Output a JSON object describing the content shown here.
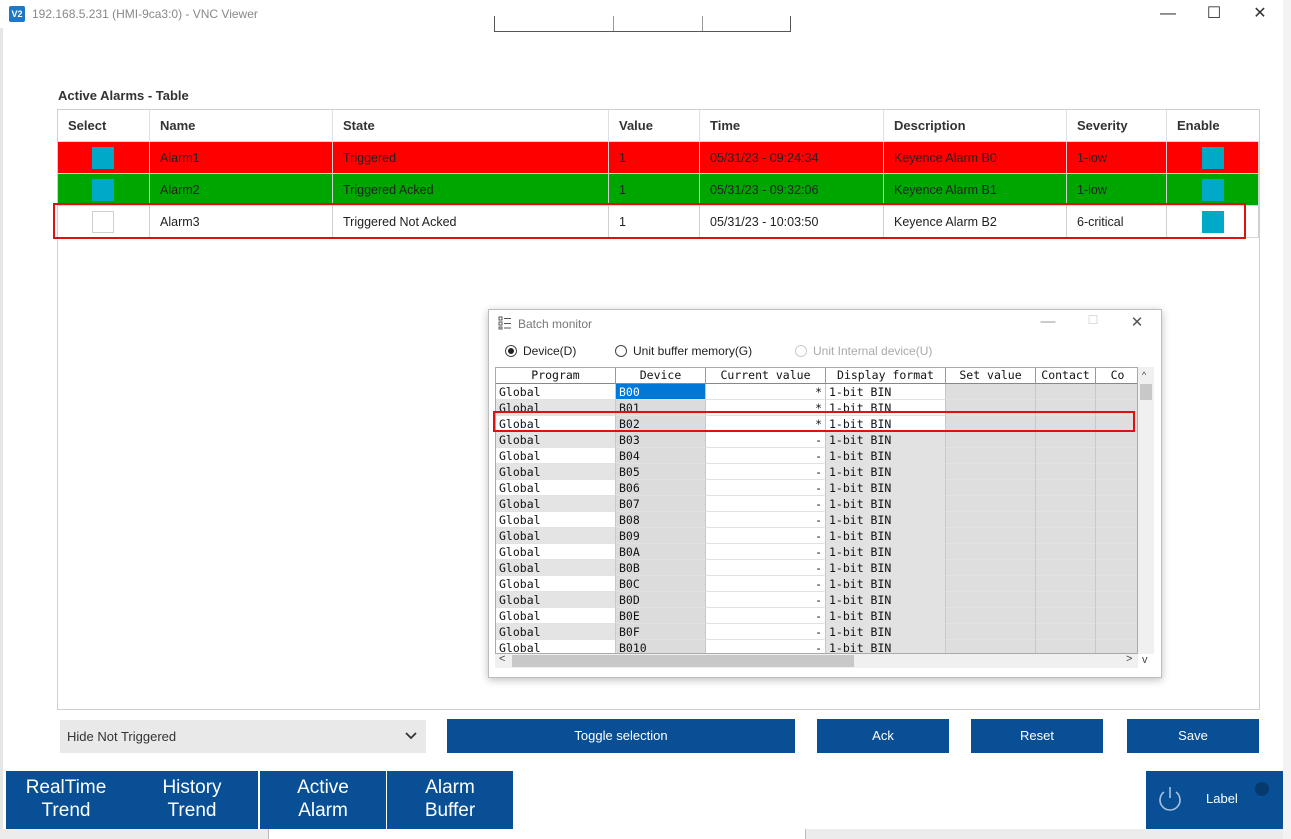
{
  "window": {
    "logo": "V2",
    "title": "192.168.5.231 (HMI-9ca3:0) - VNC Viewer",
    "min": "—",
    "max": "☐",
    "close": "✕"
  },
  "alarms": {
    "title": "Active Alarms - Table",
    "headers": [
      "Select",
      "Name",
      "State",
      "Value",
      "Time",
      "Description",
      "Severity",
      "Enable"
    ],
    "rows": [
      {
        "selected": true,
        "name": "Alarm1",
        "state": "Triggered",
        "value": "1",
        "time": "05/31/23 - 09:24:34",
        "description": "Keyence Alarm B0",
        "severity": "1-low",
        "enabled": true,
        "row_color": "#ff0000"
      },
      {
        "selected": true,
        "name": "Alarm2",
        "state": "Triggered Acked",
        "value": "1",
        "time": "05/31/23 - 09:32:06",
        "description": "Keyence Alarm B1",
        "severity": "1-low",
        "enabled": true,
        "row_color": "#00a600"
      },
      {
        "selected": false,
        "name": "Alarm3",
        "state": "Triggered Not Acked",
        "value": "1",
        "time": "05/31/23 - 10:03:50",
        "description": "Keyence Alarm B2",
        "severity": "6-critical",
        "enabled": true,
        "row_color": "#ffffff"
      }
    ]
  },
  "controls": {
    "filter_value": "Hide Not Triggered",
    "toggle_label": "Toggle selection",
    "ack_label": "Ack",
    "reset_label": "Reset",
    "save_label": "Save"
  },
  "nav": {
    "tabs": [
      {
        "line1": "RealTime",
        "line2": "Trend"
      },
      {
        "line1": "History",
        "line2": "Trend"
      },
      {
        "line1": "Active",
        "line2": "Alarm"
      },
      {
        "line1": "Alarm",
        "line2": "Buffer"
      }
    ],
    "label_button": "Label"
  },
  "batch_monitor": {
    "title": "Batch monitor",
    "radio_options": [
      {
        "label": "Device(D)",
        "selected": true,
        "disabled": false
      },
      {
        "label": "Unit buffer memory(G)",
        "selected": false,
        "disabled": false
      },
      {
        "label": "Unit Internal device(U)",
        "selected": false,
        "disabled": true
      }
    ],
    "columns": [
      "Program",
      "Device",
      "Current value",
      "Display format",
      "Set value",
      "Contact",
      "Co"
    ],
    "rows": [
      [
        "Global",
        "B00",
        "*",
        "1-bit BIN"
      ],
      [
        "Global",
        "B01",
        "*",
        "1-bit BIN"
      ],
      [
        "Global",
        "B02",
        "*",
        "1-bit BIN"
      ],
      [
        "Global",
        "B03",
        "-",
        "1-bit BIN"
      ],
      [
        "Global",
        "B04",
        "-",
        "1-bit BIN"
      ],
      [
        "Global",
        "B05",
        "-",
        "1-bit BIN"
      ],
      [
        "Global",
        "B06",
        "-",
        "1-bit BIN"
      ],
      [
        "Global",
        "B07",
        "-",
        "1-bit BIN"
      ],
      [
        "Global",
        "B08",
        "-",
        "1-bit BIN"
      ],
      [
        "Global",
        "B09",
        "-",
        "1-bit BIN"
      ],
      [
        "Global",
        "B0A",
        "-",
        "1-bit BIN"
      ],
      [
        "Global",
        "B0B",
        "-",
        "1-bit BIN"
      ],
      [
        "Global",
        "B0C",
        "-",
        "1-bit BIN"
      ],
      [
        "Global",
        "B0D",
        "-",
        "1-bit BIN"
      ],
      [
        "Global",
        "B0E",
        "-",
        "1-bit BIN"
      ],
      [
        "Global",
        "B0F",
        "-",
        "1-bit BIN"
      ],
      [
        "Global",
        "B010",
        "-",
        "1-bit BIN"
      ]
    ],
    "selected_device": "B00",
    "scroll_left": "<",
    "scroll_right": ">",
    "scroll_down": "v"
  },
  "colors": {
    "accent_blue": "#084f95",
    "enable_cyan": "#00a9c7",
    "highlight_red": "#e01010"
  }
}
